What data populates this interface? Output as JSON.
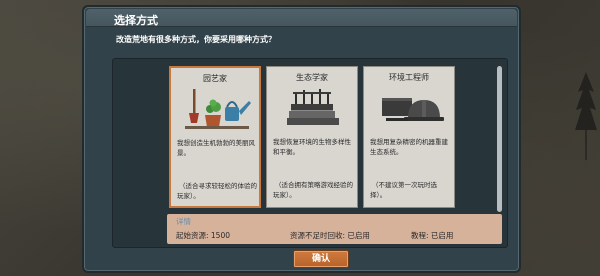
{
  "dialog": {
    "title": "选择方式",
    "prompt": "改造荒地有很多种方式，你要采用哪种方式？"
  },
  "options": [
    {
      "title": "园艺家",
      "description": "我想创造生机勃勃的美丽风景。",
      "note": "（适合寻求较轻松的体验的玩家）。",
      "selected": true,
      "icon": "gardening-tools-icon"
    },
    {
      "title": "生态学家",
      "description": "我想恢复环境的生物多样性和平衡。",
      "note": "（适合拥有策略游戏经验的玩家）。",
      "selected": false,
      "icon": "ecology-books-icon"
    },
    {
      "title": "环境工程师",
      "description": "我想用复杂精密的机器重建生态系统。",
      "note": "（不建议第一次玩时选择）。",
      "selected": false,
      "icon": "engineering-helmet-icon"
    }
  ],
  "details": {
    "heading": "详情",
    "starting_resources": "起始资源: 1500",
    "recycling": "资源不足时回收: 已启用",
    "tutorial": "教程: 已启用"
  },
  "buttons": {
    "confirm": "确认"
  },
  "colors": {
    "dialog_bg": "#32424a",
    "selected_border": "#c9793e",
    "details_bg": "#d7b29b",
    "confirm_bg": "#c46f35"
  }
}
